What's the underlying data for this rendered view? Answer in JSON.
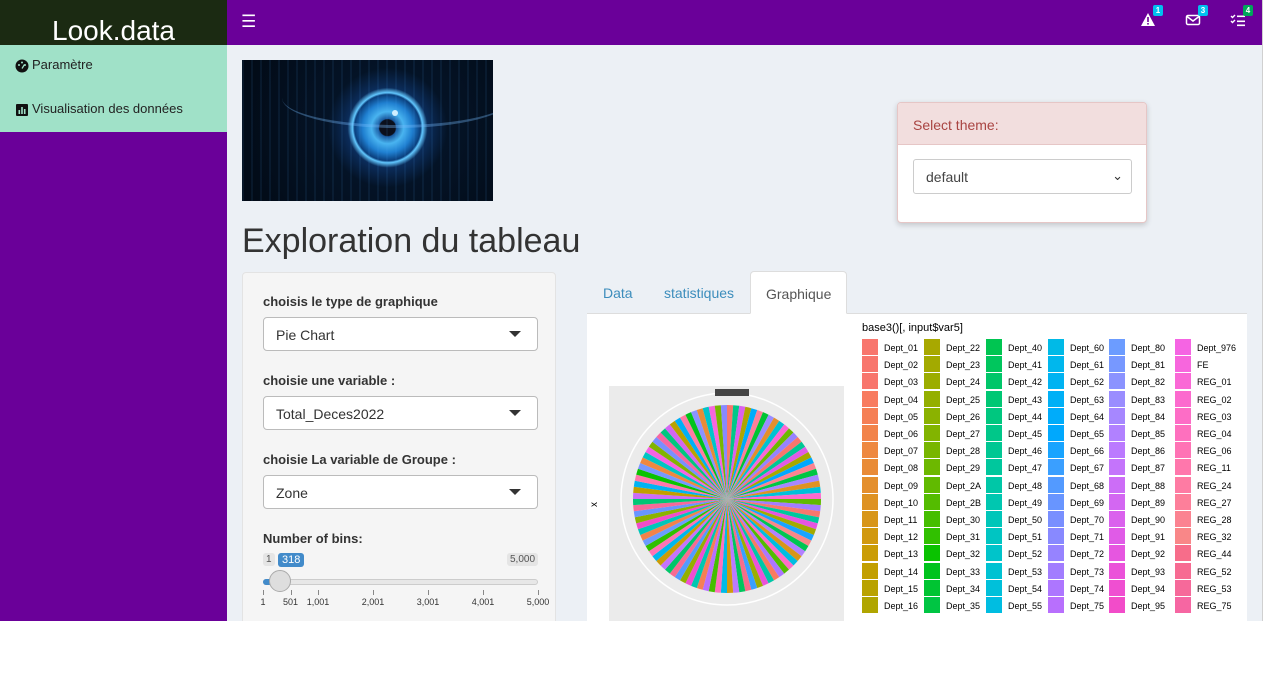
{
  "app": {
    "brand": "Look.data"
  },
  "topbar": {
    "menu_icon": "hamburger-icon",
    "notifications": [
      {
        "icon": "warning-icon",
        "badge": "1",
        "badge_color": "#00c0ef"
      },
      {
        "icon": "envelope-icon",
        "badge": "3",
        "badge_color": "#00c0ef"
      },
      {
        "icon": "tasks-icon",
        "badge": "4",
        "badge_color": "#00a65a"
      }
    ]
  },
  "sidebar": {
    "items": [
      {
        "label": "Paramètre",
        "icon": "dashboard-icon"
      },
      {
        "label": "Visualisation des données",
        "icon": "bar-chart-icon"
      }
    ]
  },
  "theme": {
    "header": "Select theme:",
    "selected": "default"
  },
  "page": {
    "title": "Exploration du tableau"
  },
  "controls": {
    "graph_type_label": "choisis le type de graphique",
    "graph_type_value": "Pie Chart",
    "variable_label": "choisie une variable :",
    "variable_value": "Total_Deces2022",
    "group_label": "choisie La variable de Groupe :",
    "group_value": "Zone",
    "bins_label": "Number of bins:",
    "bins_min": "1",
    "bins_max": "5,000",
    "bins_value": "318",
    "bins_fraction": 0.0634,
    "grid_labels": [
      "1",
      "501",
      "1,001",
      "2,001",
      "3,001",
      "4,001",
      "5,000"
    ]
  },
  "tabs": [
    {
      "label": "Data",
      "active": false
    },
    {
      "label": "statistiques",
      "active": false
    },
    {
      "label": "Graphique",
      "active": true
    }
  ],
  "chart_data": {
    "type": "pie",
    "legend_title": "base3()[, input$var5]",
    "xlabel": "x",
    "legend_columns": [
      [
        "Dept_01",
        "Dept_02",
        "Dept_03",
        "Dept_04",
        "Dept_05",
        "Dept_06",
        "Dept_07",
        "Dept_08",
        "Dept_09",
        "Dept_10",
        "Dept_11",
        "Dept_12",
        "Dept_13",
        "Dept_14",
        "Dept_15",
        "Dept_16"
      ],
      [
        "Dept_22",
        "Dept_23",
        "Dept_24",
        "Dept_25",
        "Dept_26",
        "Dept_27",
        "Dept_28",
        "Dept_29",
        "Dept_2A",
        "Dept_2B",
        "Dept_30",
        "Dept_31",
        "Dept_32",
        "Dept_33",
        "Dept_34",
        "Dept_35"
      ],
      [
        "Dept_40",
        "Dept_41",
        "Dept_42",
        "Dept_43",
        "Dept_44",
        "Dept_45",
        "Dept_46",
        "Dept_47",
        "Dept_48",
        "Dept_49",
        "Dept_50",
        "Dept_51",
        "Dept_52",
        "Dept_53",
        "Dept_54",
        "Dept_55"
      ],
      [
        "Dept_60",
        "Dept_61",
        "Dept_62",
        "Dept_63",
        "Dept_64",
        "Dept_65",
        "Dept_66",
        "Dept_67",
        "Dept_68",
        "Dept_69",
        "Dept_70",
        "Dept_71",
        "Dept_72",
        "Dept_73",
        "Dept_74",
        "Dept_75"
      ],
      [
        "Dept_80",
        "Dept_81",
        "Dept_82",
        "Dept_83",
        "Dept_84",
        "Dept_85",
        "Dept_86",
        "Dept_87",
        "Dept_88",
        "Dept_89",
        "Dept_90",
        "Dept_91",
        "Dept_92",
        "Dept_93",
        "Dept_94",
        "Dept_95"
      ],
      [
        "Dept_976",
        "FE",
        "REG_01",
        "REG_02",
        "REG_03",
        "REG_04",
        "REG_06",
        "REG_11",
        "REG_24",
        "REG_27",
        "REG_28",
        "REG_32",
        "REG_44",
        "REG_52",
        "REG_53",
        "REG_75"
      ]
    ],
    "legend_colors": [
      [
        "#f8766d",
        "#f8766d",
        "#f8766d",
        "#f87b5f",
        "#f57f55",
        "#f2834a",
        "#ee8840",
        "#e98b36",
        "#e48f2d",
        "#de9223",
        "#d89619",
        "#d1990f",
        "#ca9c06",
        "#c29f00",
        "#b9a200",
        "#b0a500"
      ],
      [
        "#a8a800",
        "#a3aa00",
        "#9cad00",
        "#94af00",
        "#8bb200",
        "#82b400",
        "#78b600",
        "#6db800",
        "#61ba00",
        "#54bc00",
        "#45be00",
        "#31c000",
        "#0ac200",
        "#00c31c",
        "#00c432",
        "#00c543"
      ],
      [
        "#00c551",
        "#00c65d",
        "#00c669",
        "#00c774",
        "#00c77f",
        "#00c789",
        "#00c793",
        "#00c79d",
        "#00c7a7",
        "#00c7b0",
        "#00c6b9",
        "#00c5c2",
        "#00c4ca",
        "#00c2d2",
        "#00c0da",
        "#00bde1"
      ],
      [
        "#00bae7",
        "#00b7ed",
        "#00b3f2",
        "#00b0f6",
        "#00acfa",
        "#00a8fd",
        "#19a4ff",
        "#3a9fff",
        "#539aff",
        "#6895ff",
        "#798fff",
        "#8889ff",
        "#9683ff",
        "#a27dff",
        "#ad76ff",
        "#b86ffd"
      ],
      [
        "#6c9cff",
        "#7798ff",
        "#8b93ff",
        "#9a8dff",
        "#a687ff",
        "#b181ff",
        "#bb7aff",
        "#c474fb",
        "#cc6df7",
        "#d367f2",
        "#da61ed",
        "#e05be7",
        "#e656e0",
        "#eb52d9",
        "#ef4fd1",
        "#f24cc9"
      ],
      [
        "#f564e3",
        "#f766dd",
        "#fa68d6",
        "#fc6ace",
        "#fd6dc6",
        "#fe70be",
        "#ff73b5",
        "#ff77ac",
        "#fe7ba3",
        "#fd7f9a",
        "#fb8391",
        "#f98788",
        "#f76d8a",
        "#f76b92",
        "#f6699a",
        "#f666a2"
      ]
    ]
  }
}
